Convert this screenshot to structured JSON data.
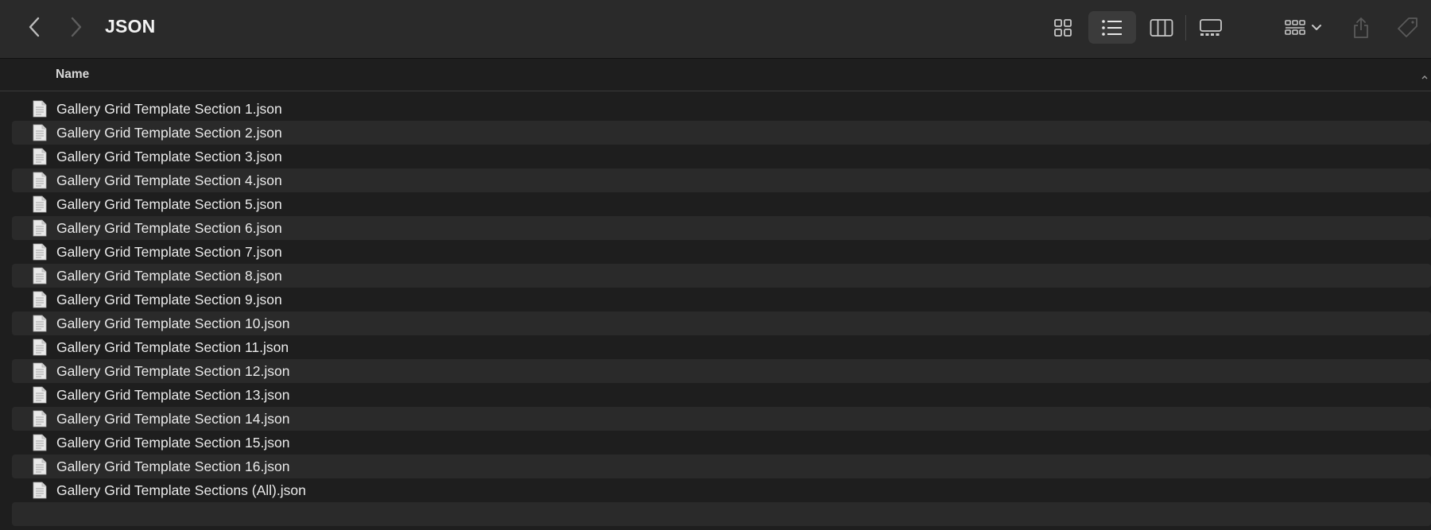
{
  "window": {
    "title": "JSON"
  },
  "toolbar": {
    "back_icon": "chevron-left-icon",
    "forward_icon": "chevron-right-icon",
    "views": [
      {
        "name": "icon-view",
        "icon": "grid-icon",
        "selected": false
      },
      {
        "name": "list-view",
        "icon": "list-icon",
        "selected": true
      },
      {
        "name": "column-view",
        "icon": "columns-icon",
        "selected": false
      },
      {
        "name": "gallery-view",
        "icon": "gallery-icon",
        "selected": false
      }
    ],
    "group_icon": "group-by-icon",
    "share_icon": "share-icon",
    "tag_icon": "tag-icon"
  },
  "columns": {
    "name_label": "Name"
  },
  "files": [
    {
      "name": "Gallery Grid Template Section 1.json"
    },
    {
      "name": "Gallery Grid Template Section 2.json"
    },
    {
      "name": "Gallery Grid Template Section 3.json"
    },
    {
      "name": "Gallery Grid Template Section 4.json"
    },
    {
      "name": "Gallery Grid Template Section 5.json"
    },
    {
      "name": "Gallery Grid Template Section 6.json"
    },
    {
      "name": "Gallery Grid Template Section 7.json"
    },
    {
      "name": "Gallery Grid Template Section 8.json"
    },
    {
      "name": "Gallery Grid Template Section 9.json"
    },
    {
      "name": "Gallery Grid Template Section 10.json"
    },
    {
      "name": "Gallery Grid Template Section 11.json"
    },
    {
      "name": "Gallery Grid Template Section 12.json"
    },
    {
      "name": "Gallery Grid Template Section 13.json"
    },
    {
      "name": "Gallery Grid Template Section 14.json"
    },
    {
      "name": "Gallery Grid Template Section 15.json"
    },
    {
      "name": "Gallery Grid Template Section 16.json"
    },
    {
      "name": "Gallery Grid Template Sections (All).json"
    }
  ],
  "colors": {
    "background": "#1e1e1e",
    "toolbar": "#2a2a2a",
    "alt_row": "#2a2a2a",
    "text": "#eaeaea"
  }
}
